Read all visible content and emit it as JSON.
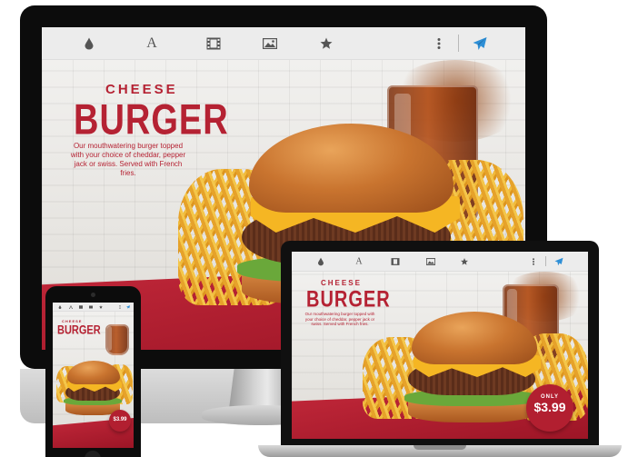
{
  "toolbar": {
    "icons": [
      "droplet-icon",
      "text-icon",
      "film-icon",
      "image-icon",
      "star-icon",
      "more-vertical-icon",
      "send-icon"
    ],
    "accent": "#2e8fd6",
    "icon_color": "#555555"
  },
  "ad": {
    "headline_small": "CHEESE",
    "headline_large": "BURGER",
    "description": "Our mouthwatering burger topped with your choice of cheddar, pepper jack or swiss. Served with French fries.",
    "price_prefix": "ONLY",
    "price": "$3.99",
    "brand_red": "#b52233"
  }
}
